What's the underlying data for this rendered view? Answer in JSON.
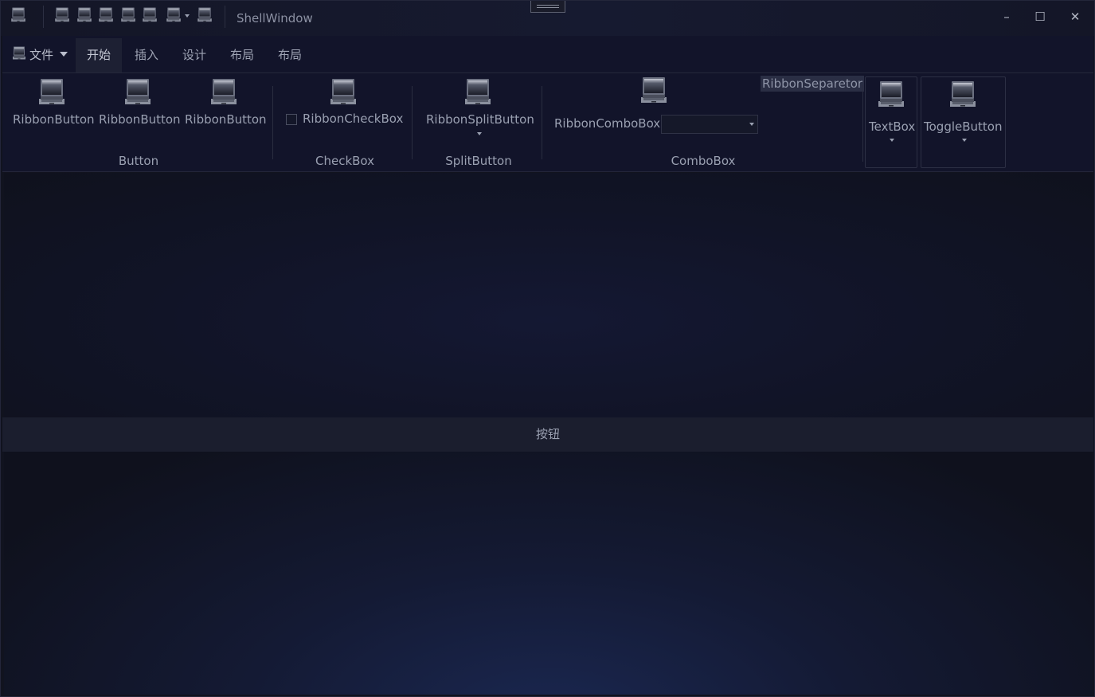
{
  "window": {
    "title": "ShellWindow"
  },
  "window_controls": {
    "minimize": "–",
    "maximize": "☐",
    "close": "✕"
  },
  "menu": {
    "file_label": "文件"
  },
  "tabs": [
    {
      "label": "开始",
      "active": true
    },
    {
      "label": "插入",
      "active": false
    },
    {
      "label": "设计",
      "active": false
    },
    {
      "label": "布局",
      "active": false
    },
    {
      "label": "布局",
      "active": false
    }
  ],
  "ribbon": {
    "buttons": [
      "RibbonButton",
      "RibbonButton",
      "RibbonButton"
    ],
    "checkbox_label": "RibbonCheckBox",
    "split_button_label": "RibbonSplitButton",
    "combobox_label": "RibbonComboBox",
    "combobox_value": "",
    "separator_label": "RibbonSeparetor",
    "textbox_label": "TextBox",
    "toggle_label": "ToggleButton",
    "groups": [
      "Button",
      "CheckBox",
      "SplitButton",
      "ComboBox"
    ]
  },
  "content": {
    "button_label": "按钮"
  },
  "colors": {
    "background": "#11131f",
    "ribbon": "#12142a",
    "accent_bar": "#1b1e2e"
  }
}
